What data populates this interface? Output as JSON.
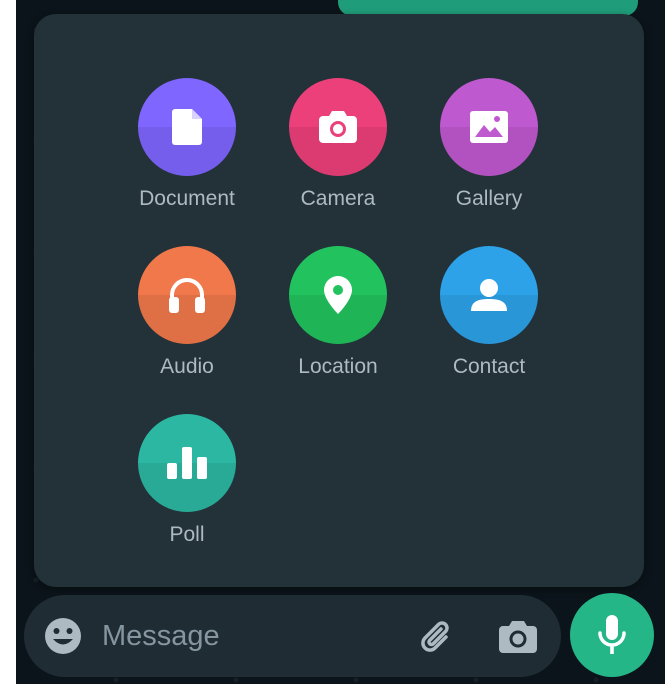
{
  "attach_menu": {
    "items": [
      {
        "label": "Document",
        "icon": "document-icon",
        "color": "#7f66ff"
      },
      {
        "label": "Camera",
        "icon": "camera-icon",
        "color": "#ec407a"
      },
      {
        "label": "Gallery",
        "icon": "gallery-icon",
        "color": "#bf59cf"
      },
      {
        "label": "Audio",
        "icon": "headphones-icon",
        "color": "#f0784a"
      },
      {
        "label": "Location",
        "icon": "location-pin-icon",
        "color": "#22c35e"
      },
      {
        "label": "Contact",
        "icon": "contact-icon",
        "color": "#2da2e8"
      },
      {
        "label": "Poll",
        "icon": "poll-icon",
        "color": "#2cb7a2"
      }
    ]
  },
  "composer": {
    "placeholder": "Message",
    "emoji_icon": "emoji-icon",
    "attach_icon": "paperclip-icon",
    "camera_icon": "camera-icon",
    "mic_icon": "microphone-icon",
    "mic_color": "#25b687"
  }
}
